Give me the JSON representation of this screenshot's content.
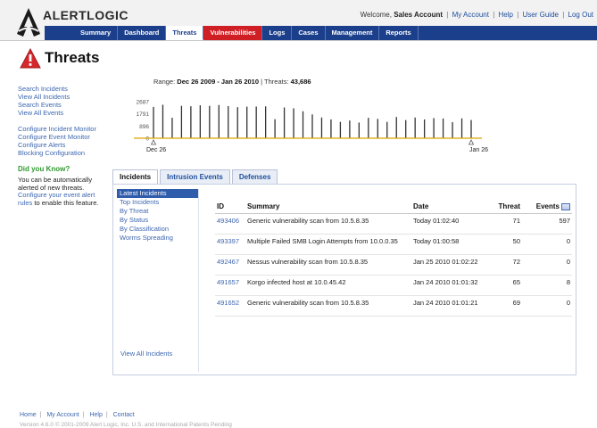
{
  "header": {
    "logo_text": "ALERTLOGIC",
    "welcome_prefix": "Welcome,",
    "user_name": "Sales Account",
    "links": [
      "My Account",
      "Help",
      "User Guide",
      "Log Out"
    ]
  },
  "nav": {
    "tabs": [
      "Summary",
      "Dashboard",
      "Threats",
      "Vulnerabilities",
      "Logs",
      "Cases",
      "Management",
      "Reports"
    ],
    "active": "Threats"
  },
  "page": {
    "title": "Threats"
  },
  "sidebar": {
    "group1": [
      "Search Incidents",
      "View All Incidents",
      "Search Events",
      "View All Events"
    ],
    "group2": [
      "Configure Incident Monitor",
      "Configure Event Monitor",
      "Configure Alerts",
      "Blocking Configuration"
    ],
    "did_you_know": {
      "title": "Did you Know?",
      "text_before": "You can be automatically alerted of new threats.",
      "link": "Configure your event alert rules",
      "text_after": "to enable this feature."
    }
  },
  "chart": {
    "range_label": "Range:",
    "range_value": "Dec 26 2009 - Jan 26 2010",
    "threats_label": "| Threats:",
    "threats_value": "43,686",
    "start_label": "Dec 26",
    "end_label": "Jan 26"
  },
  "chart_data": {
    "type": "bar",
    "y_ticks": [
      0,
      896,
      1791,
      2687
    ],
    "ylim": [
      0,
      2687
    ],
    "x_tick_labels": [
      "Dec 26",
      "Jan 26"
    ],
    "values": [
      2300,
      2460,
      1500,
      2380,
      2350,
      2420,
      2380,
      2440,
      2360,
      2280,
      2320,
      2330,
      2340,
      1400,
      2260,
      2200,
      1980,
      1750,
      1520,
      1380,
      1200,
      1300,
      1150,
      1500,
      1420,
      1200,
      1560,
      1330,
      1520,
      1380,
      1480,
      1450,
      1180,
      1460,
      1340
    ]
  },
  "tabs": {
    "items": [
      "Incidents",
      "Intrusion Events",
      "Defenses"
    ],
    "active": "Incidents"
  },
  "subnav": {
    "items": [
      "Latest Incidents",
      "Top Incidents",
      "By Threat",
      "By Status",
      "By Classification",
      "Worms Spreading"
    ],
    "active": "Latest Incidents",
    "bottom_link": "View All Incidents"
  },
  "table": {
    "columns": [
      "ID",
      "Summary",
      "Date",
      "Threat",
      "Events"
    ],
    "rows": [
      {
        "id": "493406",
        "summary": "Generic vulnerability scan from 10.5.8.35",
        "date": "Today 01:02:40",
        "threat": "71",
        "events": "597"
      },
      {
        "id": "493397",
        "summary": "Multiple Failed SMB Login Attempts from 10.0.0.35",
        "date": "Today 01:00:58",
        "threat": "50",
        "events": "0"
      },
      {
        "id": "492467",
        "summary": "Nessus vulnerability scan from 10.5.8.35",
        "date": "Jan 25 2010 01:02:22",
        "threat": "72",
        "events": "0"
      },
      {
        "id": "491657",
        "summary": "Korgo infected host at 10.0.45.42",
        "date": "Jan 24 2010 01:01:32",
        "threat": "65",
        "events": "8"
      },
      {
        "id": "491652",
        "summary": "Generic vulnerability scan from 10.5.8.35",
        "date": "Jan 24 2010 01:01:21",
        "threat": "69",
        "events": "0"
      }
    ]
  },
  "footer": {
    "links": [
      "Home",
      "My Account",
      "Help",
      "Contact"
    ],
    "version_line": "Version 4.6.0 © 2001-2009 Alert Logic, Inc. U.S. and International Patents Pending"
  },
  "colors": {
    "nav_bg": "#1c3f8c",
    "vuln_tab": "#cf1f25",
    "link": "#3d67b0",
    "dyk_green": "#2f9a2f",
    "spark_bar": "#333333",
    "spark_base": "#d9a300"
  }
}
